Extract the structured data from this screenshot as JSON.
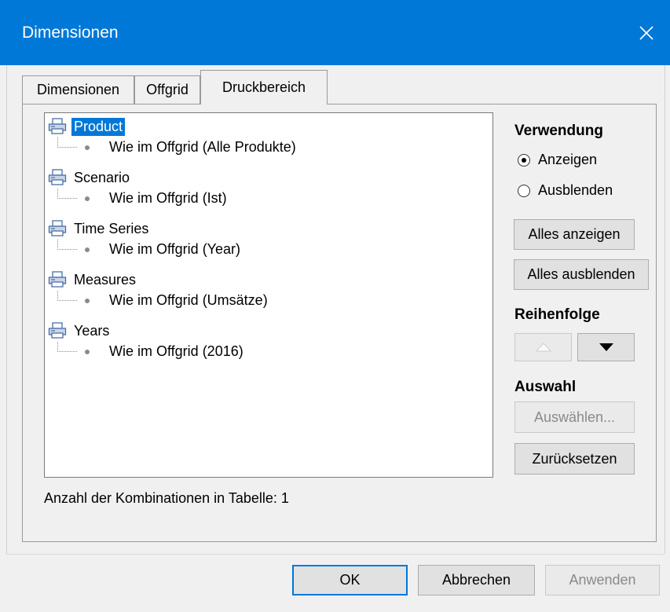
{
  "window": {
    "title": "Dimensionen",
    "close_icon": "close-icon"
  },
  "tabs": [
    {
      "label": "Dimensionen"
    },
    {
      "label": "Offgrid"
    },
    {
      "label": "Druckbereich"
    }
  ],
  "tree": [
    {
      "label": "Product",
      "child": "Wie im Offgrid (Alle Produkte)"
    },
    {
      "label": "Scenario",
      "child": "Wie im Offgrid (Ist)"
    },
    {
      "label": "Time Series",
      "child": "Wie im Offgrid (Year)"
    },
    {
      "label": "Measures",
      "child": "Wie im Offgrid (Umsätze)"
    },
    {
      "label": "Years",
      "child": "Wie im Offgrid (2016)"
    }
  ],
  "side": {
    "verwendung_title": "Verwendung",
    "radio_show": "Anzeigen",
    "radio_hide": "Ausblenden",
    "show_all": "Alles anzeigen",
    "hide_all": "Alles ausblenden",
    "order_title": "Reihenfolge",
    "selection_title": "Auswahl",
    "select_btn": "Auswählen...",
    "reset_btn": "Zurücksetzen"
  },
  "status": {
    "text": "Anzahl der Kombinationen in Tabelle: 1"
  },
  "footer": {
    "ok": "OK",
    "cancel": "Abbrechen",
    "apply": "Anwenden"
  }
}
